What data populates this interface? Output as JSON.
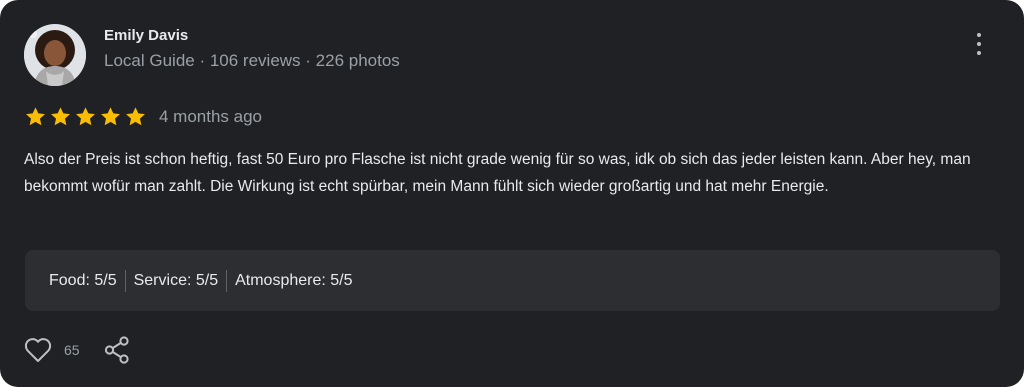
{
  "review": {
    "author": {
      "name": "Emily Davis",
      "meta": "Local Guide · 106 reviews · 226 photos"
    },
    "rating": 5,
    "rating_max": 5,
    "time": "4 months ago",
    "text": "Also der Preis ist schon heftig, fast 50 Euro pro Flasche ist nicht grade wenig für so was, idk ob sich das jeder leisten kann. Aber hey, man bekommt wofür man zahlt. Die Wirkung ist echt spürbar, mein Mann fühlt sich wieder großartig und hat mehr Energie.",
    "attributes": [
      {
        "label": "Food: 5/5"
      },
      {
        "label": "Service: 5/5"
      },
      {
        "label": "Atmosphere: 5/5"
      }
    ],
    "likes": "65"
  },
  "icons": {
    "avatar": "user-photo",
    "more": "more-vert-icon",
    "star": "star-icon",
    "like": "heart-outline-icon",
    "share": "share-icon"
  },
  "colors": {
    "card_bg": "#202124",
    "star": "#fbbc04",
    "text": "#e8eaed",
    "muted": "#9aa0a6",
    "attr_bg": "#2d2e31"
  }
}
